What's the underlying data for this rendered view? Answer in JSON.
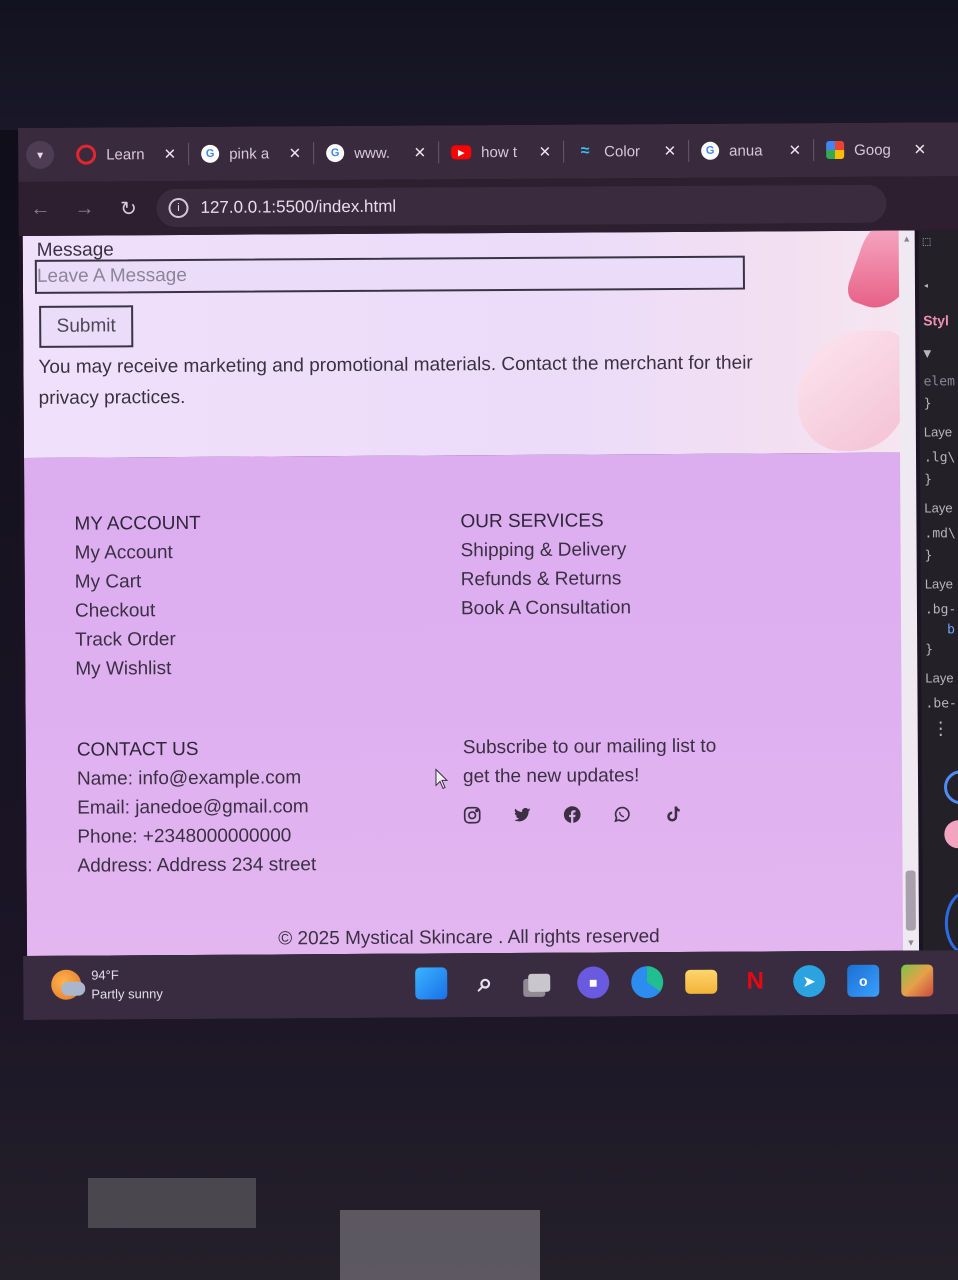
{
  "browser": {
    "tabs": [
      {
        "title": "Learn",
        "icon": "opera-icon",
        "icon_color": "#e3262e"
      },
      {
        "title": "pink a",
        "icon": "google-icon",
        "icon_color": "#ffffff"
      },
      {
        "title": "www.",
        "icon": "google-icon",
        "icon_color": "#ffffff"
      },
      {
        "title": "how t",
        "icon": "youtube-icon",
        "icon_color": "#ff0000"
      },
      {
        "title": "Color",
        "icon": "tailwind-icon",
        "icon_color": "#38bdf8"
      },
      {
        "title": "anua",
        "icon": "google-icon",
        "icon_color": "#ffffff"
      },
      {
        "title": "Goog",
        "icon": "google-photos-icon",
        "icon_color": "#fbbc04"
      }
    ],
    "close_glyph": "✕",
    "url": "127.0.0.1:5500/index.html"
  },
  "form": {
    "message_label": "Message",
    "message_placeholder": "Leave A Message",
    "submit_label": "Submit",
    "disclaimer": "You may receive marketing and promotional materials. Contact the merchant for their privacy practices."
  },
  "footer": {
    "account": {
      "heading": "MY ACCOUNT",
      "links": [
        "My Account",
        "My Cart",
        "Checkout",
        "Track Order",
        "My Wishlist"
      ]
    },
    "services": {
      "heading": "OUR SERVICES",
      "links": [
        "Shipping & Delivery",
        "Refunds & Returns",
        "Book A Consultation"
      ]
    },
    "contact": {
      "heading": "CONTACT US",
      "lines": [
        "Name: info@example.com",
        "Email: janedoe@gmail.com",
        "Phone: +2348000000000",
        "Address: Address 234 street"
      ]
    },
    "subscribe": {
      "text_line1": "Subscribe to our mailing list to",
      "text_line2": "get the new updates!"
    },
    "social_icons": [
      "instagram-icon",
      "twitter-icon",
      "facebook-icon",
      "whatsapp-icon",
      "tiktok-icon"
    ],
    "copyright": "© 2025 Mystical Skincare . All rights reserved"
  },
  "devtools": {
    "rows": [
      "Styl",
      "elem",
      "}",
      "Laye",
      ".lg\\",
      "}",
      "Laye",
      ".md\\",
      "}",
      "Laye",
      ".bg-",
      "b",
      "}",
      "Laye",
      ".be-",
      "⋮"
    ]
  },
  "taskbar": {
    "temperature": "94°F",
    "condition": "Partly sunny",
    "apps": [
      "windows-start-icon",
      "search-icon",
      "task-view-icon",
      "teams-icon",
      "edge-icon",
      "file-explorer-icon",
      "netflix-icon",
      "telegram-icon",
      "outlook-icon",
      "game-icon"
    ]
  },
  "colors": {
    "footer_bg": "#deb0f0",
    "form_bg": "#ecdcfa",
    "text": "#3a2f43",
    "devtools_accent": "#f08fb0"
  }
}
